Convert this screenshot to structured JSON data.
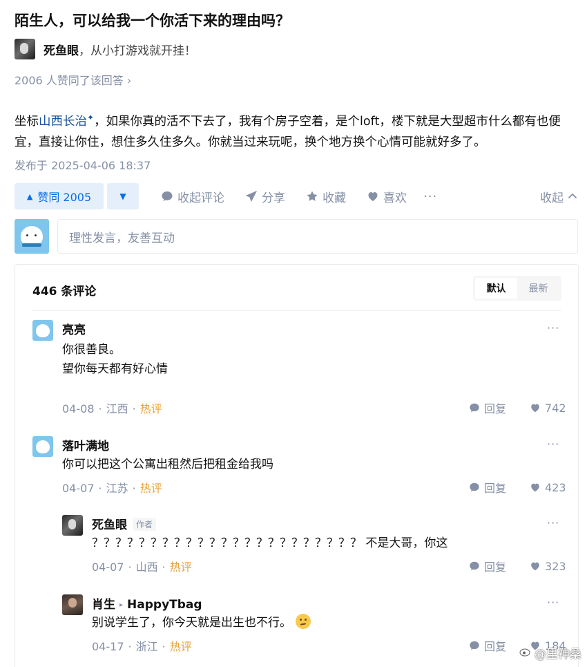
{
  "question": {
    "title": "陌生人，可以给我一个你活下来的理由吗？"
  },
  "answer": {
    "author_name": "死鱼眼",
    "author_bio": "，从小打游戏就开挂！",
    "upvote_summary": "2006 人赞同了该回答 ›",
    "body_prefix": "坐标",
    "body_location": "山西长治",
    "body_location_mark": "✦",
    "body_rest": "，如果你真的活不下去了，我有个房子空着，是个loft，楼下就是大型超市什么都有也便宜，直接让你住，想住多久住多久。你就当过来玩呢，换个地方换个心情可能就好多了。",
    "publish_time": "发布于 2025-04-06 18:37"
  },
  "actions": {
    "upvote_label": "赞同 2005",
    "downvote_symbol": "▼",
    "collapse_comments": "收起评论",
    "share": "分享",
    "favorite": "收藏",
    "like": "喜欢",
    "more": "···",
    "collapse": "收起"
  },
  "comment_box": {
    "placeholder": "理性发言，友善互动"
  },
  "comments_section": {
    "count_label": "446 条评论",
    "sort_default": "默认",
    "sort_latest": "最新"
  },
  "comments": [
    {
      "name": "亮亮",
      "lines": [
        "你很善良。",
        "望你每天都有好心情"
      ],
      "date": "04-08",
      "region": "江西",
      "hot": "热评",
      "reply": "回复",
      "likes": "742"
    },
    {
      "name": "落叶满地",
      "lines": [
        "你可以把这个公寓出租然后把租金给我吗"
      ],
      "date": "04-07",
      "region": "江苏",
      "hot": "热评",
      "reply": "回复",
      "likes": "423"
    },
    {
      "name": "死鱼眼",
      "tag": "作者",
      "lines": [
        "？？？？？？？？？？？？？？？？？？？？？？？ 不是大哥，你这"
      ],
      "date": "04-07",
      "region": "山西",
      "hot": "热评",
      "reply": "回复",
      "likes": "323"
    },
    {
      "name": "肖生",
      "reply_to": "HappyTbag",
      "lines": [
        "别说学生了，你今天就是出生也不行。"
      ],
      "date": "04-17",
      "region": "浙江",
      "hot": "热评",
      "reply": "回复",
      "likes": "184"
    }
  ],
  "watermark": "@里神桑"
}
